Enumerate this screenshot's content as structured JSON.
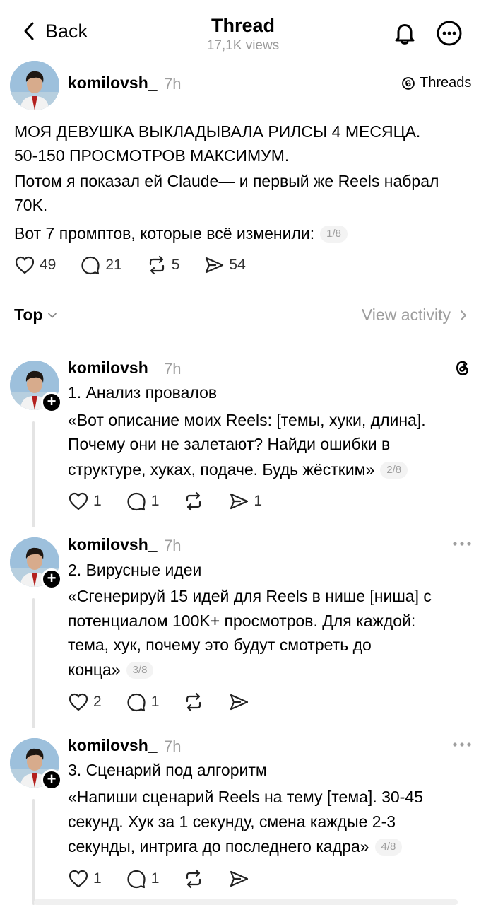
{
  "header": {
    "back_label": "Back",
    "title": "Thread",
    "views": "17,1K views"
  },
  "main_post": {
    "username": "komilovsh_",
    "time": "7h",
    "badge": "Threads",
    "text": {
      "line1": "МОЯ ДЕВУШКА ВЫКЛАДЫВАЛА РИЛСЫ 4 МЕСЯЦА.",
      "line2": "50-150 ПРОСМОТРОВ МАКСИМУМ.",
      "line3": "Потом я показал ей Claude— и первый же Reels набрал",
      "line4": "70K.",
      "line5": "Вот 7 промптов, которые всё изменили:"
    },
    "counter": "1/8",
    "likes": "49",
    "comments": "21",
    "reposts": "5",
    "shares": "54"
  },
  "filter": {
    "sort_label": "Top",
    "view_activity": "View activity"
  },
  "replies": [
    {
      "username": "komilovsh_",
      "time": "7h",
      "heading": "1. Анализ провалов",
      "line1": "«Вот описание моих Reels: [темы, хуки, длина].",
      "line2": "Почему они не залетают? Найди ошибки в",
      "line3": "структуре, хуках, подаче. Будь жёстким»",
      "counter": "2/8",
      "likes": "1",
      "comments": "1",
      "shares": "1"
    },
    {
      "username": "komilovsh_",
      "time": "7h",
      "heading": "2. Вирусные идеи",
      "line1": "«Сгенерируй 15 идей для Reels в нише [ниша] с",
      "line2": "потенциалом 100K+ просмотров. Для каждой:",
      "line3": "тема, хук, почему это будут смотреть до",
      "line4": "конца»",
      "counter": "3/8",
      "likes": "2",
      "comments": "1"
    },
    {
      "username": "komilovsh_",
      "time": "7h",
      "heading": "3. Сценарий под алгоритм",
      "line1": "«Напиши сценарий Reels на тему [тема]. 30-45",
      "line2": "секунд. Хук за 1 секунду, смена каждые 2-3",
      "line3": "секунды, интрига до последнего кадра»",
      "counter": "4/8",
      "likes": "1",
      "comments": "1"
    }
  ],
  "icons": {
    "back": "chevron-left-icon",
    "notify": "bell-icon",
    "more": "more-circle-icon",
    "like": "heart-icon",
    "comment": "comment-icon",
    "repost": "repost-icon",
    "share": "send-icon",
    "threads": "threads-logo-icon"
  },
  "colors": {
    "text": "#000000",
    "muted": "#9e9e9e",
    "divider": "#e6e6e6"
  }
}
